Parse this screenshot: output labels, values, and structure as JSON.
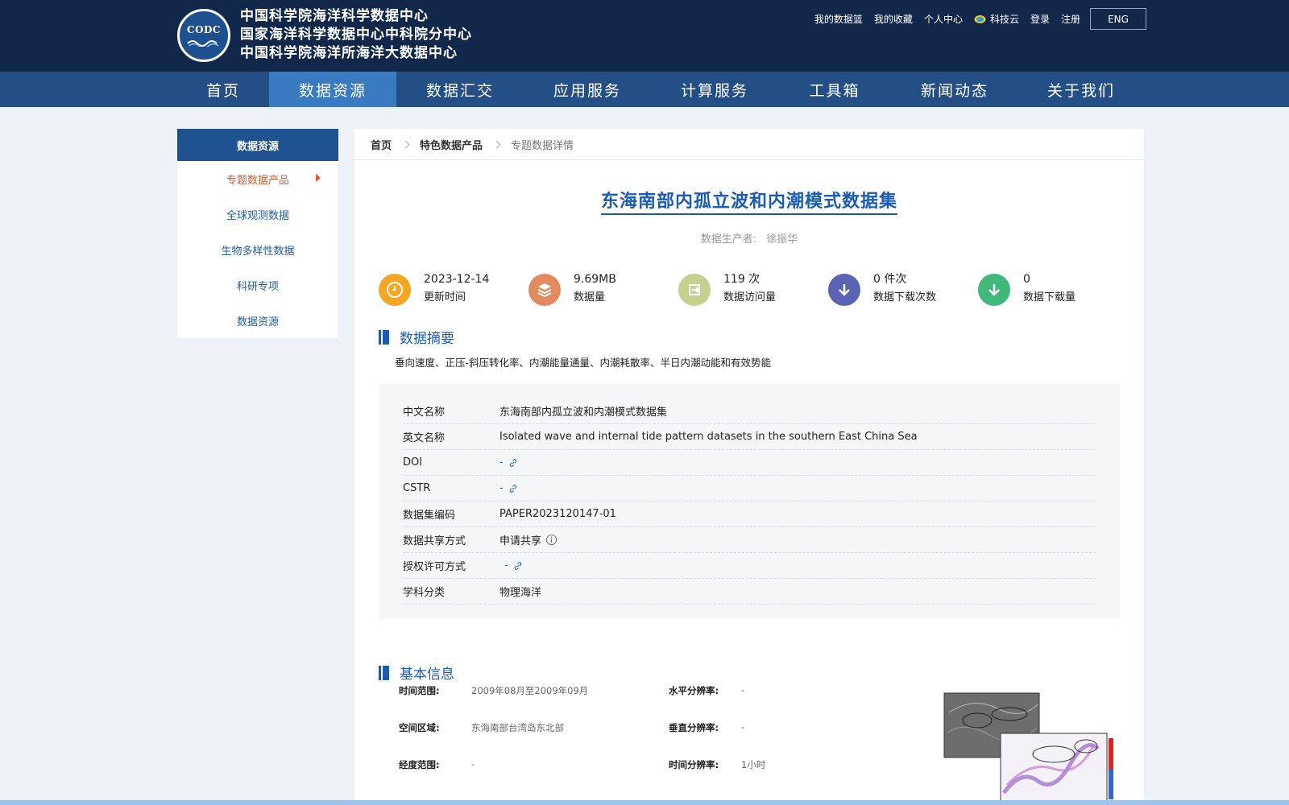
{
  "header": {
    "logo_text": "CODC",
    "org_names": [
      "中国科学院海洋科学数据中心",
      "国家海洋科学数据中心中科院分中心",
      "中国科学院海洋所海洋大数据中心"
    ],
    "util_links": [
      "我的数据篮",
      "我的收藏",
      "个人中心",
      "科技云",
      "登录",
      "注册"
    ],
    "lang_button": "ENG"
  },
  "nav": {
    "items": [
      "首页",
      "数据资源",
      "数据汇交",
      "应用服务",
      "计算服务",
      "工具箱",
      "新闻动态",
      "关于我们"
    ],
    "active_index": 1
  },
  "sidebar": {
    "title": "数据资源",
    "items": [
      "专题数据产品",
      "全球观测数据",
      "生物多样性数据",
      "科研专项",
      "数据资源"
    ]
  },
  "breadcrumb": [
    "首页",
    "特色数据产品",
    "专题数据详情"
  ],
  "dataset": {
    "title": "东海南部内孤立波和内潮模式数据集",
    "producer_label": "数据生产者:",
    "producer_name": "徐振华"
  },
  "stats": [
    {
      "value": "2023-12-14",
      "label": "更新时间",
      "icon": "clock-icon",
      "color": "#f5a623"
    },
    {
      "value": "9.69MB",
      "label": "数据量",
      "icon": "layers-icon",
      "color": "#e08a5e"
    },
    {
      "value": "119 次",
      "label": "数据访问量",
      "icon": "login-icon",
      "color": "#c6d08f"
    },
    {
      "value": "0 件次",
      "label": "数据下载次数",
      "icon": "download-icon",
      "color": "#5a63b1"
    },
    {
      "value": "0",
      "label": "数据下载量",
      "icon": "download-icon",
      "color": "#3fb87a"
    }
  ],
  "abstract": {
    "heading": "数据摘要",
    "text": "垂向速度、正压-斜压转化率、内潮能量通量、内潮耗散率、半日内潮动能和有效势能"
  },
  "info": {
    "cn_name_label": "中文名称",
    "cn_name": "东海南部内孤立波和内潮模式数据集",
    "en_name_label": "英文名称",
    "en_name": "Isolated wave and internal tide pattern datasets in the southern East China Sea",
    "doi_label": "DOI",
    "doi": "-",
    "cstr_label": "CSTR",
    "cstr": "-",
    "code_label": "数据集编码",
    "code": "PAPER2023120147-01",
    "share_label": "数据共享方式",
    "share": "申请共享",
    "license_label": "授权许可方式",
    "license": "-",
    "subject_label": "学科分类",
    "subject": "物理海洋"
  },
  "basic": {
    "heading": "基本信息",
    "time_range_label": "时间范围:",
    "time_range": "2009年08月至2009年09月",
    "horiz_res_label": "水平分辨率:",
    "horiz_res": "-",
    "region_label": "空间区域:",
    "region": "东海南部台湾岛东北部",
    "vert_res_label": "垂直分辨率:",
    "vert_res": "-",
    "lon_range_label": "经度范围:",
    "lon_range": "-",
    "time_res_label": "时间分辨率:",
    "time_res": "1小时"
  },
  "colors": {
    "header_bg": "#12284a",
    "nav_bg": "#234f86",
    "nav_active": "#3a7ac0",
    "accent_blue": "#1a5bb5",
    "sidebar_active": "#e0582c"
  }
}
